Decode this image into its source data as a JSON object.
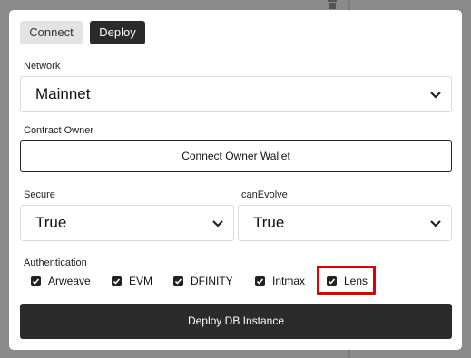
{
  "background": {
    "trash_icon": "trash-icon"
  },
  "tabs": {
    "connect_label": "Connect",
    "deploy_label": "Deploy",
    "active": "Deploy"
  },
  "network": {
    "label": "Network",
    "selected": "Mainnet",
    "icon": "chevron-down-icon"
  },
  "contract_owner": {
    "label": "Contract Owner",
    "button_label": "Connect Owner Wallet"
  },
  "secure": {
    "label": "Secure",
    "selected": "True"
  },
  "can_evolve": {
    "label": "canEvolve",
    "selected": "True"
  },
  "authentication": {
    "label": "Authentication",
    "options": [
      {
        "label": "Arweave",
        "checked": true
      },
      {
        "label": "EVM",
        "checked": true
      },
      {
        "label": "DFINITY",
        "checked": true
      },
      {
        "label": "Intmax",
        "checked": true
      },
      {
        "label": "Lens",
        "checked": true
      }
    ]
  },
  "deploy_button": {
    "label": "Deploy DB Instance"
  },
  "colors": {
    "primary_dark": "#2b2b2b",
    "highlight": "#e00000",
    "secondary_button": "#e3e3e3"
  }
}
